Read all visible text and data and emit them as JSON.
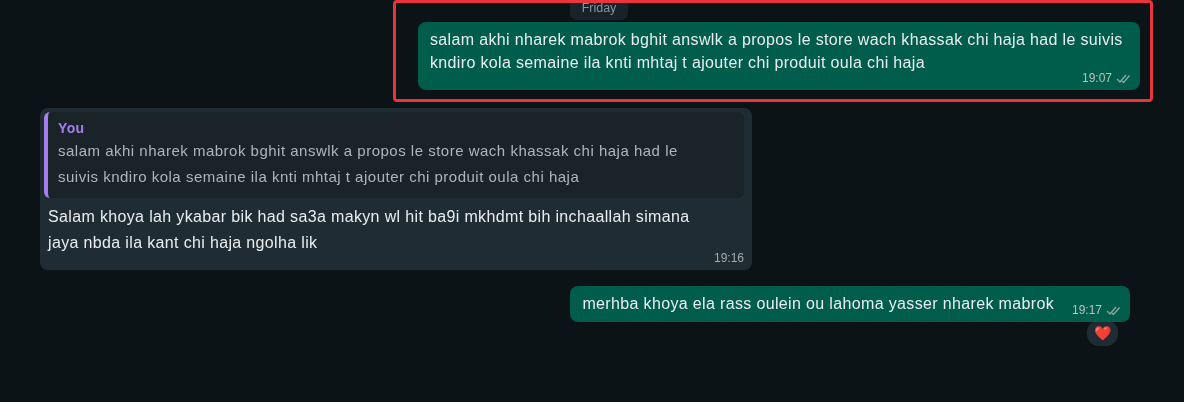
{
  "date_chip": "Friday",
  "messages": [
    {
      "kind": "outgoing",
      "highlighted": true,
      "text": "salam akhi nharek mabrok bghit answlk a propos le store wach khassak chi haja had le suivis kndiro kola semaine ila knti mhtaj t ajouter chi produit oula chi haja",
      "time": "19:07"
    },
    {
      "kind": "incoming",
      "highlighted": false,
      "quote": {
        "author": "You",
        "text": "salam akhi nharek mabrok bghit answlk a propos le store wach khassak chi haja had le suivis kndiro kola semaine ila knti mhtaj t ajouter chi produit oula chi haja"
      },
      "text": "Salam khoya lah ykabar bik had sa3a makyn wl hit ba9i mkhdmt bih inchaallah simana jaya nbda ila kant chi haja ngolha lik",
      "time": "19:16"
    },
    {
      "kind": "outgoing",
      "highlighted": false,
      "text": "merhba khoya ela rass oulein ou lahoma yasser nharek mabrok",
      "time": "19:17",
      "reaction": "❤️"
    }
  ]
}
